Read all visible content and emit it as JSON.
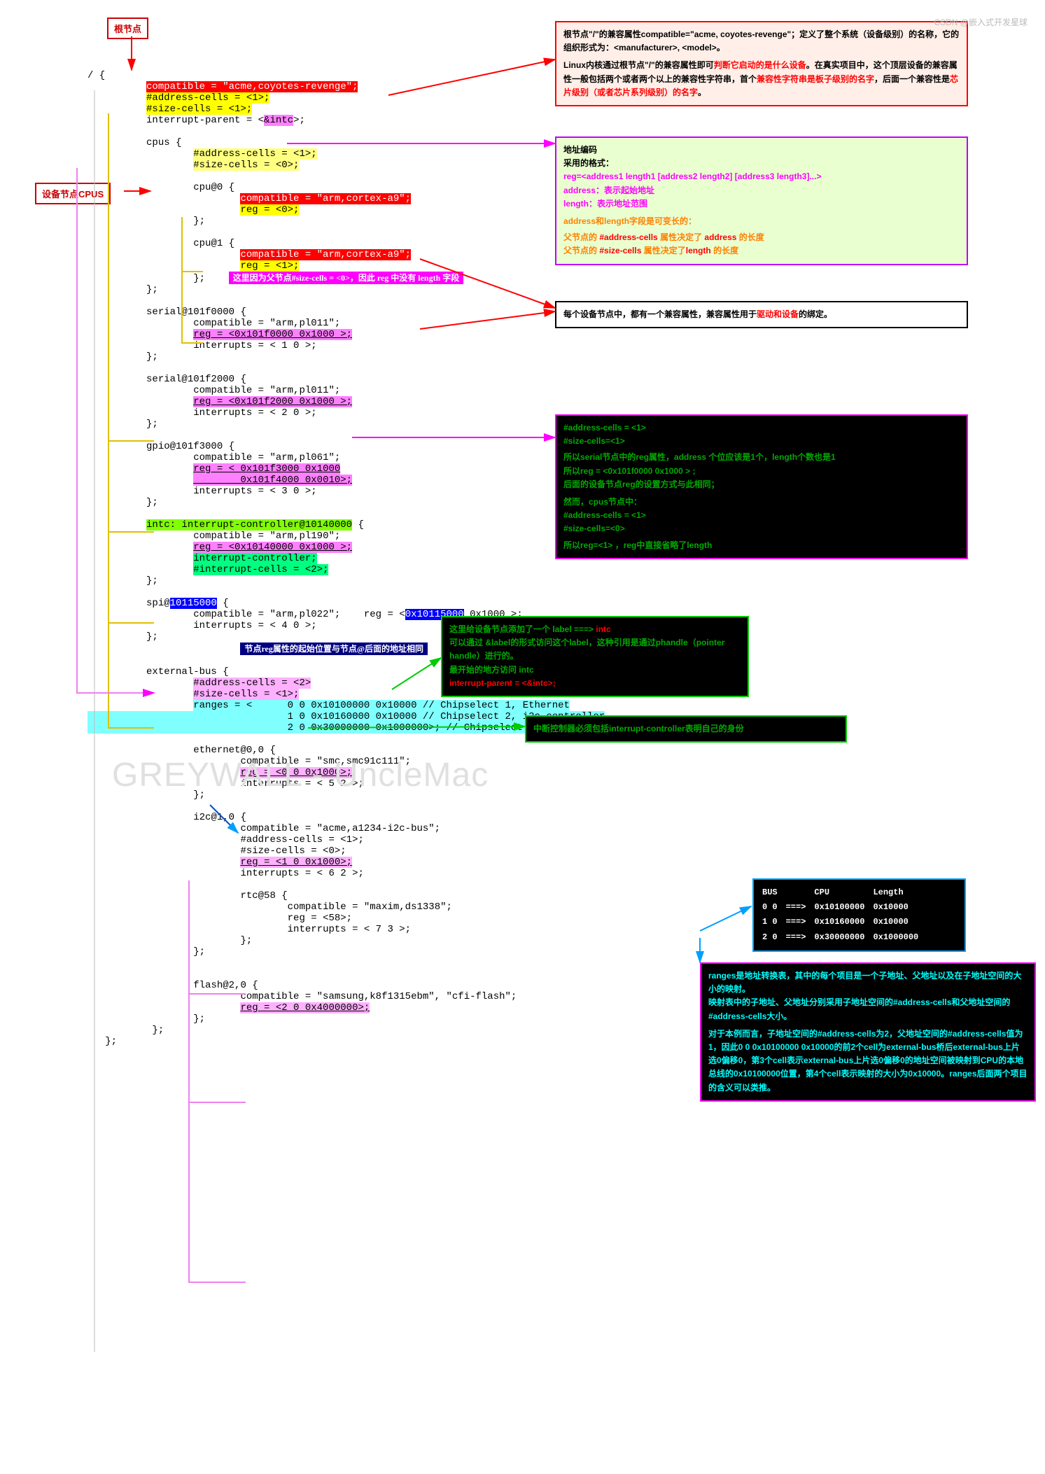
{
  "labels": {
    "root": "根节点",
    "devnode": "设备节点CPUS"
  },
  "code": {
    "root_open": "/ {",
    "compatible_root": "compatible = \"acme,coyotes-revenge\";",
    "addr1": "#address-cells = <1>;",
    "size1": "#size-cells = <1>;",
    "intp_pre": "interrupt-parent = <",
    "intp_mid": "&intc",
    "intp_post": ">;",
    "cpus_open": "cpus {",
    "cpus_addr": "#address-cells = <1>;",
    "cpus_size": "#size-cells = <0>;",
    "cpu0_open": "cpu@0 {",
    "cpu_comp": "compatible = \"arm,cortex-a9\";",
    "cpu0_reg": "reg = <0>;",
    "close": "};",
    "cpu1_open": "cpu@1 {",
    "cpu1_reg": "reg = <1>;",
    "note_reg": "这里因为父节点#size-cells = <0>，因此 reg 中没有 length 字段",
    "serial0_open": "serial@101f0000 {",
    "serial0_comp": "compatible = \"arm,pl011\";",
    "serial0_reg": "reg = <0x101f0000 0x1000 >;",
    "serial0_int": "interrupts = < 1 0 >;",
    "serial1_open": "serial@101f2000 {",
    "serial1_reg": "reg = <0x101f2000 0x1000 >;",
    "serial1_int": "interrupts = < 2 0 >;",
    "gpio_open": "gpio@101f3000 {",
    "gpio_comp": "compatible = \"arm,pl061\";",
    "gpio_reg1": "reg = < 0x101f3000 0x1000",
    "gpio_reg2": "        0x101f4000 0x0010>;",
    "gpio_int": "interrupts = < 3 0 >;",
    "intc_open_pre": "intc: interrupt-controller@10140000",
    "intc_open_post": " {",
    "intc_comp": "compatible = \"arm,pl190\";",
    "intc_reg": "reg = <0x10140000 0x1000 >;",
    "intc_ctrl": "interrupt-controller;",
    "intc_cells": "#interrupt-cells = <2>;",
    "spi_pre": "spi@",
    "spi_addr": "10115000",
    "spi_post": " {",
    "spi_comp_pre": "compatible = \"arm,pl022\";    reg = <",
    "spi_comp_mid": "0x10115000",
    "spi_comp_post": " 0x1000 >;",
    "spi_int": "interrupts = < 4 0 >;",
    "note_spi": "节点reg属性的起始位置与节点@后面的地址相同",
    "ext_open": "external-bus {",
    "ext_addr": "#address-cells = <2>",
    "ext_size": "#size-cells = <1>;",
    "ext_r1": "ranges = <      0 0 0x10100000 0x10000 // Chipselect 1, Ethernet",
    "ext_r2": "                1 0 0x10160000 0x10000 // Chipselect 2, i2c controller",
    "ext_r3": "                2 0 0x30000000 0x1000000>; // Chipselect 3, NOR Flash",
    "eth_open": "ethernet@0,0 {",
    "eth_comp": "compatible = \"smc,smc91c111\";",
    "eth_reg": "reg = <0 0 0x1000>;",
    "eth_int": "interrupts = < 5 2 >;",
    "i2c_open": "i2c@1,0 {",
    "i2c_comp": "compatible = \"acme,a1234-i2c-bus\";",
    "i2c_addr": "#address-cells = <1>;",
    "i2c_size": "#size-cells = <0>;",
    "i2c_reg": "reg = <1 0 0x1000>;",
    "i2c_int": "interrupts = < 6 2 >;",
    "rtc_open": "rtc@58 {",
    "rtc_comp": "compatible = \"maxim,ds1338\";",
    "rtc_reg": "reg = <58>;",
    "rtc_int": "interrupts = < 7 3 >;",
    "flash_open": "flash@2,0 {",
    "flash_comp": "compatible = \"samsung,k8f1315ebm\", \"cfi-flash\";",
    "flash_reg": "reg = <2 0 0x4000000>;"
  },
  "boxes": {
    "root1": "根节点\"/\"的兼容属性compatible=\"acme, coyotes-revenge\"；定义了整个系统（设备级别）的名称，它的组织形式为：<manufacturer>, <model>。",
    "root2a": "Linux内核通过根节点\"/\"的兼容属性即可",
    "root2b": "判断它启动的是什么设备",
    "root2c": "。在真实项目中，这个顶层设备的兼容属性一般包括两个或者两个以上的兼容性字符串，首个",
    "root2d": "兼容性字符串是板子级别的名字",
    "root2e": "，后面一个兼容性是",
    "root2f": "芯片级别（或者芯片系列级别）的名字",
    "root2g": "。",
    "addr_t": "地址编码",
    "addr_sub": "    采用的格式：",
    "addr_fmt": "reg=<address1 length1 [address2 length2] [address3 length3]...>",
    "addr_a": "address：表示起始地址",
    "addr_l": "length：表示地址范围",
    "addr_var": "address和length字段是可变长的：",
    "addr_p1": "父节点的 #address-cells 属性决定了 address 的长度",
    "addr_p2": "父节点的 #size-cells 属性决定了length 的长度",
    "compat": "每个设备节点中，都有一个兼容属性，兼容属性用于",
    "compat_hl": "驱动和设备",
    "compat_end": "的绑定。",
    "cells_a": "#address-cells = <1>",
    "cells_s": "#size-cells=<1>",
    "cells_p": "所以serial节点中的reg属性，address 个位应该是1个，length个数也是1",
    "cells_reg": "所以reg = <0x101f0000 0x1000 > ;",
    "cells_after": "后面的设备节点reg的设置方式与此相同；",
    "cells_but": "然而，cpus节点中：",
    "cells_a2": "#address-cells = <1>",
    "cells_s2": "#size-cells=<0>",
    "cells_res": "所以reg=<1> ，reg中直接省略了length",
    "label_t": "这里给设备节点添加了一个 label ===> ",
    "label_intc": "intc",
    "label_p": "可以通过 &label的形式访问这个label，这种引用是通过phandle（pointer handle）进行的。",
    "label_beg": "最开始的地方访问 intc",
    "label_ip": "interrupt-parent = <&intc>;",
    "ic": "中断控制器必须包括interrupt-controller表明自己的身份",
    "ranges": "ranges是地址转换表，其中的每个项目是一个子地址、父地址以及在子地址空间的大小的映射。\n映射表中的子地址、父地址分别采用子地址空间的#address-cells和父地址空间的#address-cells大小。",
    "ranges2": "对于本例而言，子地址空间的#address-cells为2，父地址空间的#address-cells值为1，因此0 0 0x10100000 0x10000的前2个cell为external-bus桥后external-bus上片选0偏移0，第3个cell表示external-bus上片选0偏移0的地址空间被映射到CPU的本地总线的0x10100000位置，第4个cell表示映射的大小为0x10000。ranges后面两个项目的含义可以类推。",
    "tbl": {
      "head": [
        "BUS",
        "",
        "CPU",
        "Length"
      ],
      "rows": [
        [
          "0  0",
          "===>",
          "0x10100000",
          "0x10000"
        ],
        [
          "1  0",
          "===>",
          "0x10160000",
          "0x10000"
        ],
        [
          "2  0",
          "===>",
          "0x30000000",
          "0x1000000"
        ]
      ]
    }
  },
  "watermark": "GREYWALL - UncleMac",
  "footer": "CSDN @嵌入式开发星球"
}
